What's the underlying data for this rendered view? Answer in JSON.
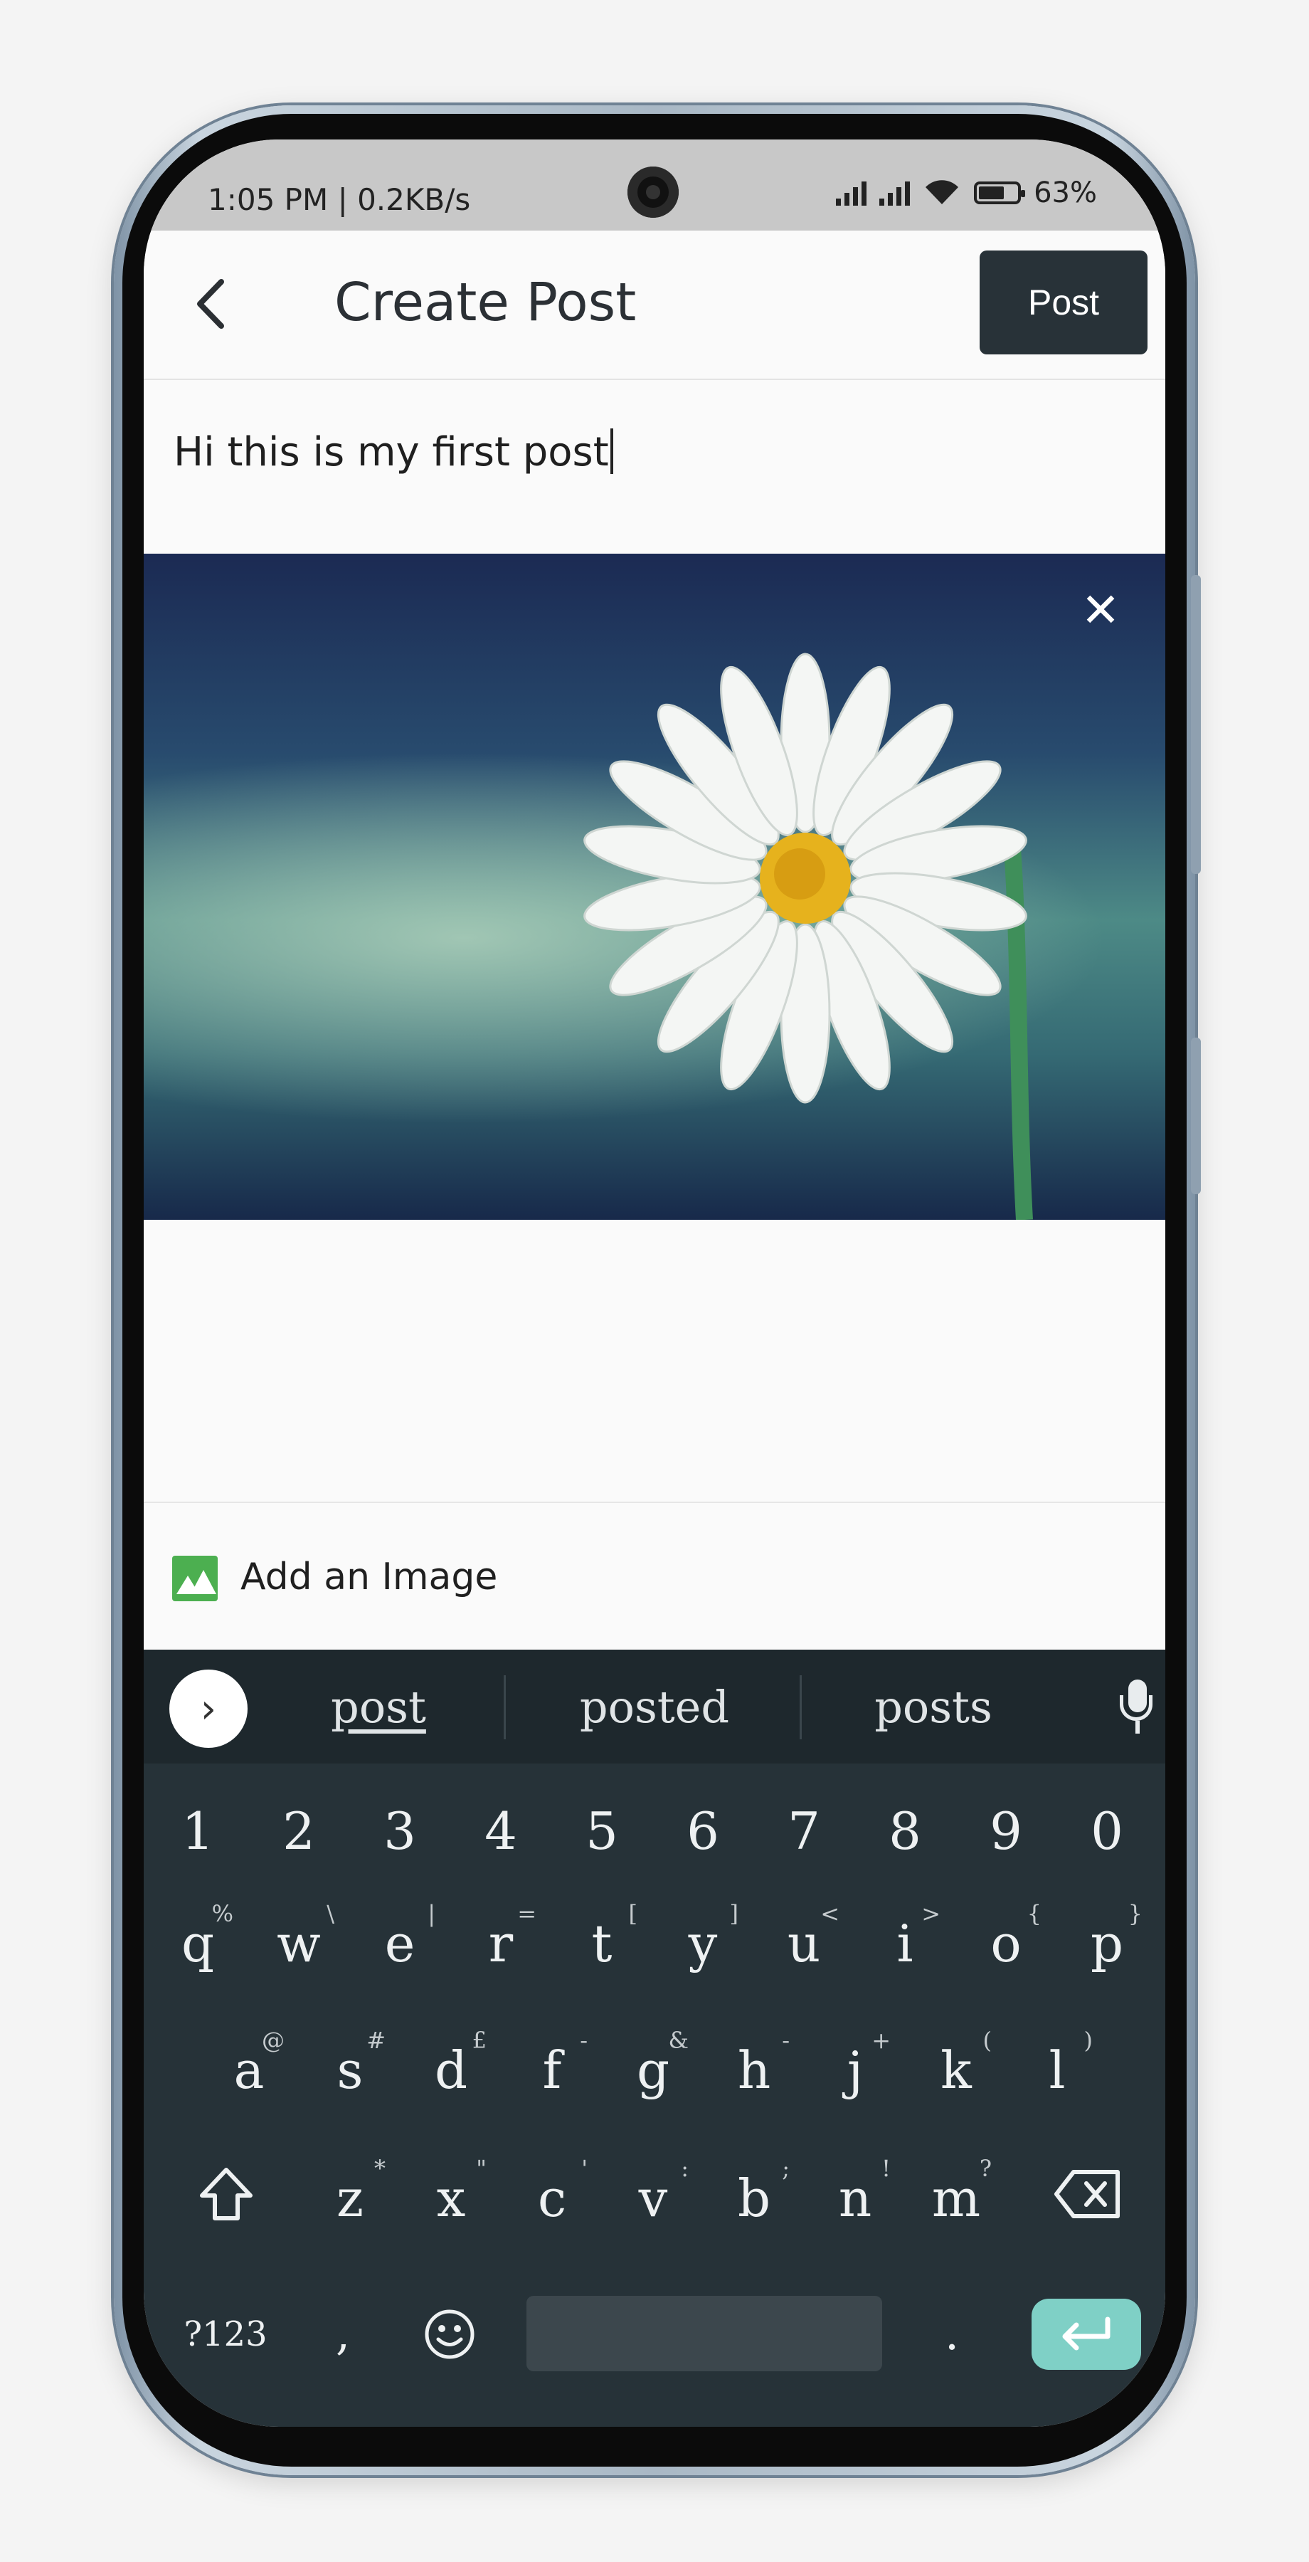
{
  "status_bar": {
    "time": "1:05 PM | 0.2KB/s",
    "battery": "63%",
    "icons": [
      "mute-icon",
      "signal-icon",
      "signal-icon",
      "wifi-icon",
      "battery-icon"
    ]
  },
  "header": {
    "back_icon": "back-arrow-icon",
    "title": "Create Post",
    "post_button": "Post"
  },
  "composer": {
    "text": "Hi this is my first post",
    "image_alt": "white daisy flower photo",
    "close_icon": "close-icon"
  },
  "attachment": {
    "icon": "image-icon",
    "label": "Add an Image"
  },
  "keyboard": {
    "suggestions": [
      "post",
      "posted",
      "posts"
    ],
    "number_row": [
      "1",
      "2",
      "3",
      "4",
      "5",
      "6",
      "7",
      "8",
      "9",
      "0"
    ],
    "row1": [
      {
        "key": "q",
        "alt": "%"
      },
      {
        "key": "w",
        "alt": "\\"
      },
      {
        "key": "e",
        "alt": "|"
      },
      {
        "key": "r",
        "alt": "="
      },
      {
        "key": "t",
        "alt": "["
      },
      {
        "key": "y",
        "alt": "]"
      },
      {
        "key": "u",
        "alt": "<"
      },
      {
        "key": "i",
        "alt": ">"
      },
      {
        "key": "o",
        "alt": "{"
      },
      {
        "key": "p",
        "alt": "}"
      }
    ],
    "row2": [
      {
        "key": "a",
        "alt": "@"
      },
      {
        "key": "s",
        "alt": "#"
      },
      {
        "key": "d",
        "alt": "£"
      },
      {
        "key": "f",
        "alt": "-"
      },
      {
        "key": "g",
        "alt": "&"
      },
      {
        "key": "h",
        "alt": "-"
      },
      {
        "key": "j",
        "alt": "+"
      },
      {
        "key": "k",
        "alt": "("
      },
      {
        "key": "l",
        "alt": ")"
      }
    ],
    "row3": [
      {
        "key": "z",
        "alt": "*"
      },
      {
        "key": "x",
        "alt": "\""
      },
      {
        "key": "c",
        "alt": "'"
      },
      {
        "key": "v",
        "alt": ":"
      },
      {
        "key": "b",
        "alt": ";"
      },
      {
        "key": "n",
        "alt": "!"
      },
      {
        "key": "m",
        "alt": "?"
      }
    ],
    "symbols_key": "?123",
    "comma": ",",
    "period": ".",
    "colors": {
      "background": "#263238",
      "enter": "#7fd0c6"
    }
  }
}
